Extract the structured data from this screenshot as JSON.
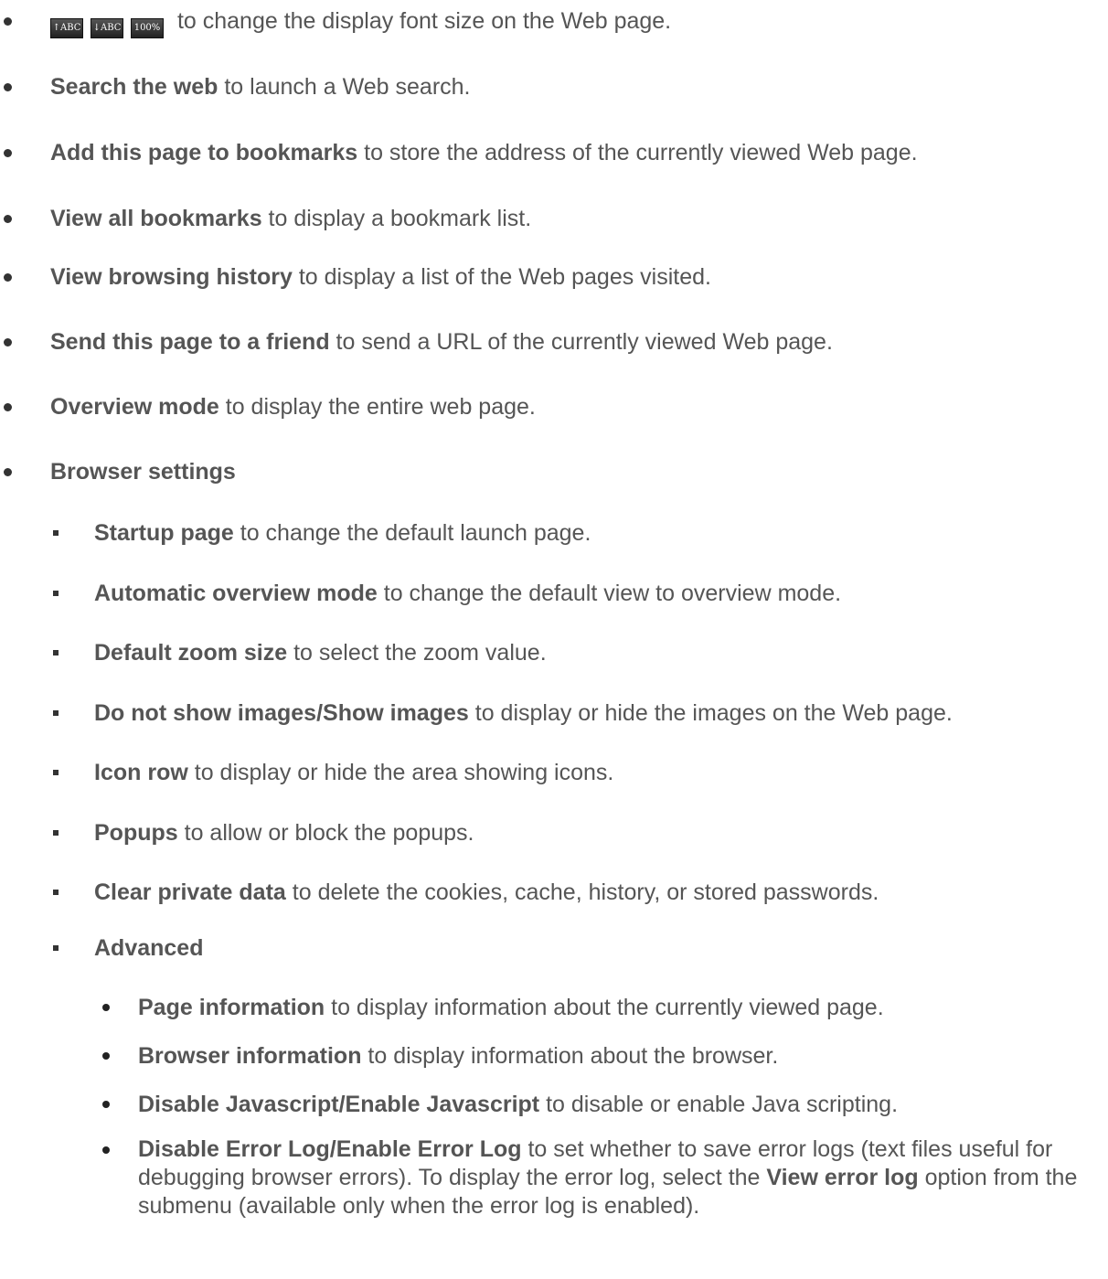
{
  "font_size_icons": [
    "↑ABC",
    "↓ABC",
    "100%"
  ],
  "font_size_text": " to change the display font size on the Web page.",
  "items": [
    {
      "bold": "Search the web",
      "text": " to launch a Web search."
    },
    {
      "bold": "Add this page to bookmarks",
      "text": " to store the address of the currently viewed Web page."
    },
    {
      "bold": "View all bookmarks",
      "text": " to display a bookmark list."
    },
    {
      "bold": "View browsing history",
      "text": " to display a list of the Web pages visited."
    },
    {
      "bold": "Send this page to a friend",
      "text": " to send a URL of the currently viewed Web page."
    },
    {
      "bold": "Overview mode",
      "text": " to display the entire web page."
    },
    {
      "bold": "Browser settings",
      "text": ""
    }
  ],
  "settings": [
    {
      "bold": "Startup page",
      "text": " to change the default launch page."
    },
    {
      "bold": "Automatic overview mode",
      "text": " to change the default view to overview mode."
    },
    {
      "bold": "Default zoom size",
      "text": " to select the zoom value."
    },
    {
      "bold": "Do not show images/Show images",
      "text": " to display or hide the images on the Web page."
    },
    {
      "bold": "Icon row",
      "text": " to display or hide the area showing icons."
    },
    {
      "bold": "Popups",
      "text": " to allow or block the popups."
    },
    {
      "bold": "Clear private data",
      "text": " to delete the cookies, cache, history, or stored passwords."
    },
    {
      "bold": "Advanced",
      "text": ""
    }
  ],
  "advanced": [
    {
      "bold": "Page information",
      "text": " to display information about the currently viewed page."
    },
    {
      "bold": "Browser information",
      "text": " to display information about the browser."
    },
    {
      "bold": "Disable Javascript/Enable Javascript",
      "text": " to disable or enable Java scripting."
    }
  ],
  "error_log": {
    "bold": "Disable Error Log/Enable Error Log",
    "text1": " to set whether to save error logs (text files useful for debugging browser errors). To display the error log, select the ",
    "bold2": "View error log",
    "text2": " option from the submenu (available only when the error log is enabled)."
  }
}
